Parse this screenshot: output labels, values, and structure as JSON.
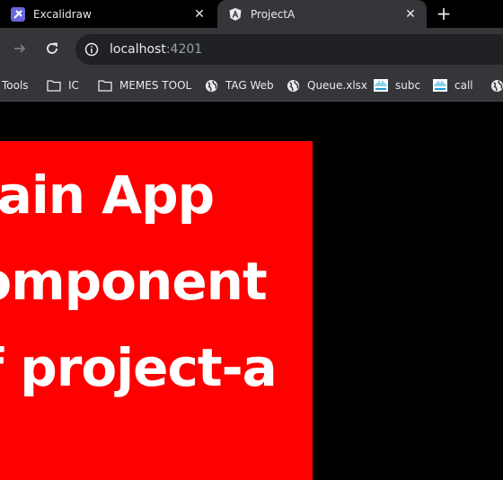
{
  "tabs": [
    {
      "title": "Excalidraw",
      "icon": "excalidraw-icon",
      "active": false
    },
    {
      "title": "ProjectA",
      "icon": "angular-icon",
      "active": true
    }
  ],
  "address_bar": {
    "host": "localhost",
    "port": ":4201"
  },
  "bookmarks": [
    {
      "label": "Tools",
      "icon": ""
    },
    {
      "label": "IC",
      "icon": "folder-icon"
    },
    {
      "label": "MEMES TOOL",
      "icon": "folder-icon"
    },
    {
      "label": "TAG Web",
      "icon": "globe-icon"
    },
    {
      "label": "Queue.xlsx",
      "icon": "globe-icon"
    },
    {
      "label": "subc",
      "icon": "cisco-icon"
    },
    {
      "label": "call",
      "icon": "cisco-icon"
    }
  ],
  "page": {
    "heading": "Main App component of project-a",
    "background": "#ff0000",
    "text_color": "#ffffff"
  }
}
